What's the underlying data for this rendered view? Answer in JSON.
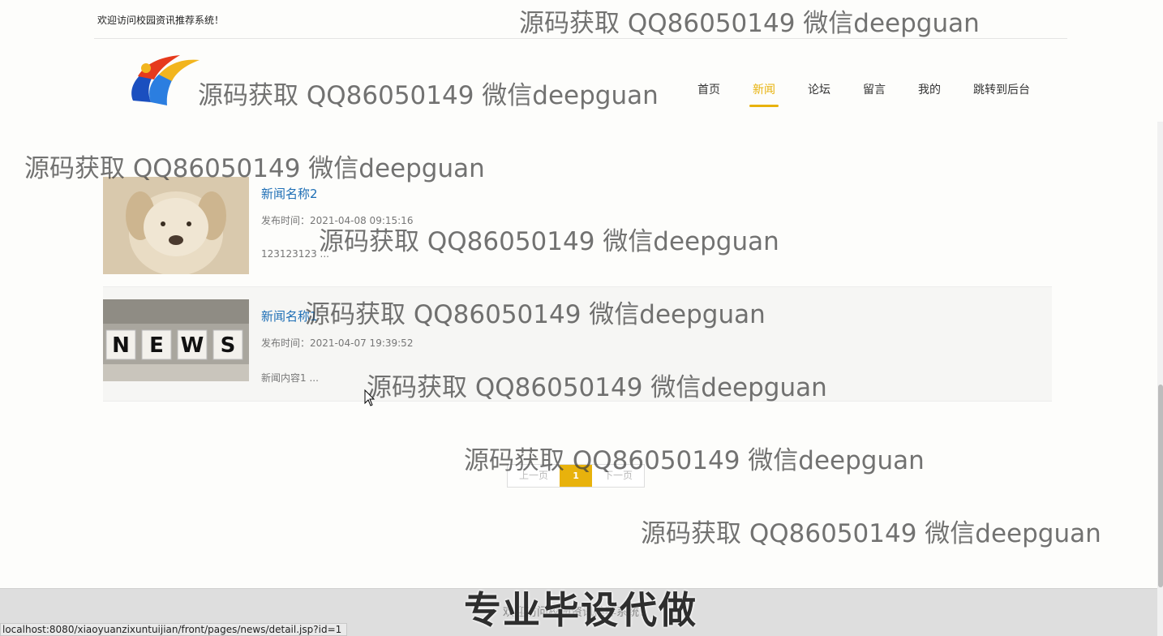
{
  "header": {
    "welcome": "欢迎访问校园资讯推荐系统！"
  },
  "nav": {
    "items": [
      {
        "label": "首页"
      },
      {
        "label": "新闻"
      },
      {
        "label": "论坛"
      },
      {
        "label": "留言"
      },
      {
        "label": "我的"
      },
      {
        "label": "跳转到后台"
      }
    ]
  },
  "news": {
    "items": [
      {
        "title": "新闻名称2",
        "meta": "发布时间：2021-04-08 09:15:16",
        "excerpt": "123123123 ..."
      },
      {
        "title": "新闻名称1",
        "meta": "发布时间：2021-04-07 19:39:52",
        "excerpt": "新闻内容1 ..."
      }
    ]
  },
  "pager": {
    "prev": "上一页",
    "current": "1",
    "next": "下一页"
  },
  "footer": {
    "text": "欢迎访问校园资讯推荐系统！",
    "banner": "专业毕设代做"
  },
  "status": {
    "url": "localhost:8080/xiaoyuanzixuntuijian/front/pages/news/detail.jsp?id=1"
  },
  "watermark": {
    "text": "源码获取 QQ86050149 微信deepguan"
  },
  "colors": {
    "accent": "#e8b20c",
    "link": "#1d6eb5"
  }
}
